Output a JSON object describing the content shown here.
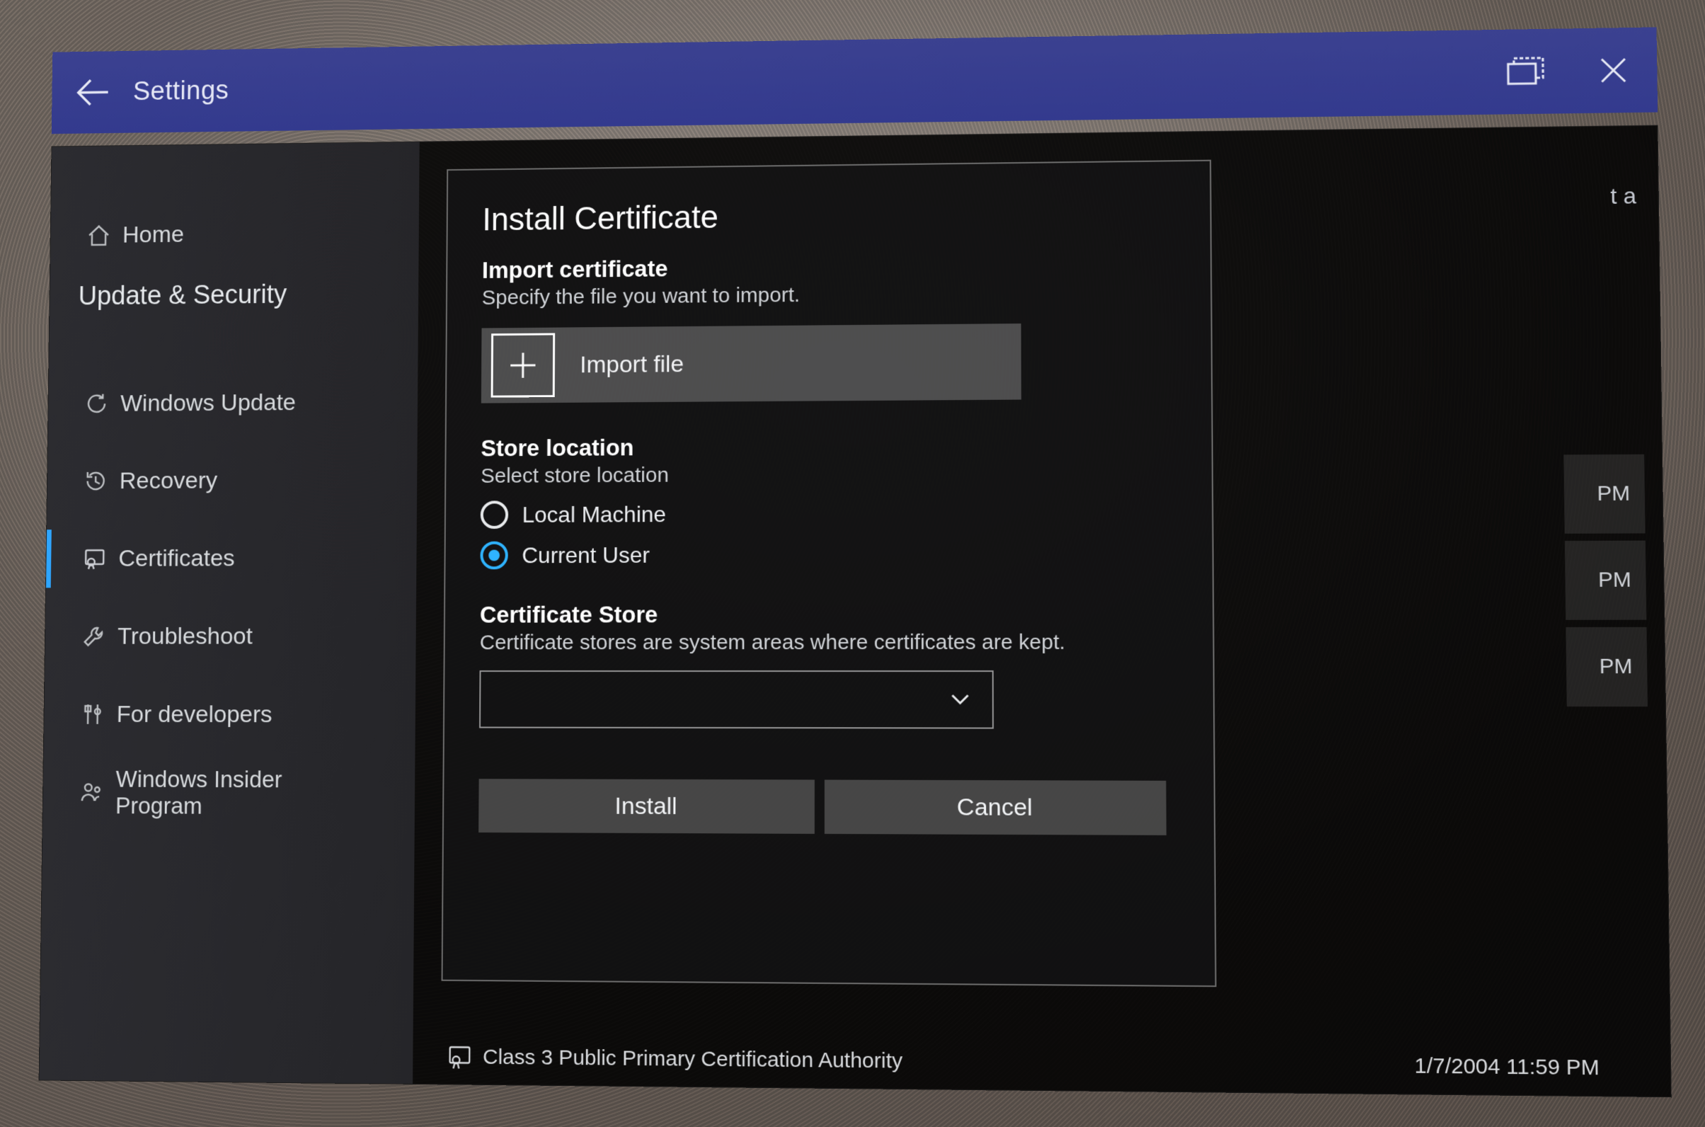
{
  "titlebar": {
    "title": "Settings"
  },
  "sidebar": {
    "home": "Home",
    "heading": "Update & Security",
    "items": [
      {
        "label": "Windows Update"
      },
      {
        "label": "Recovery"
      },
      {
        "label": "Certificates"
      },
      {
        "label": "Troubleshoot"
      },
      {
        "label": "For developers"
      },
      {
        "label": "Windows Insider\nProgram"
      }
    ],
    "active_index": 2
  },
  "dialog": {
    "title": "Install Certificate",
    "import": {
      "heading": "Import certificate",
      "sub": "Specify the file you want to import.",
      "button": "Import file"
    },
    "store_location": {
      "heading": "Store location",
      "sub": "Select store location",
      "options": [
        "Local Machine",
        "Current User"
      ],
      "selected_index": 1
    },
    "cert_store": {
      "heading": "Certificate Store",
      "sub": "Certificate stores are system areas where certificates are kept.",
      "value": ""
    },
    "buttons": {
      "install": "Install",
      "cancel": "Cancel"
    }
  },
  "background": {
    "fragment": "t a",
    "row_suffixes": [
      "PM",
      "PM",
      "PM"
    ],
    "bottom_row": {
      "name": "Class 3 Public Primary Certification Authority",
      "date": "1/7/2004 11:59 PM"
    }
  }
}
